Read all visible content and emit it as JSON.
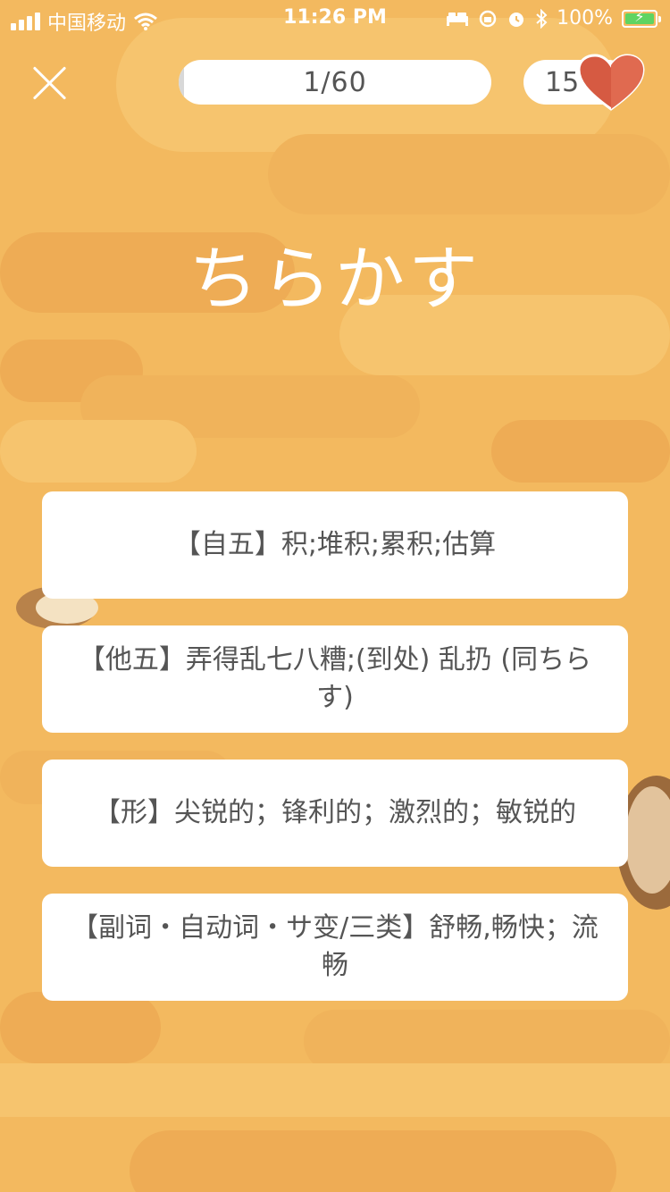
{
  "status_bar": {
    "carrier": "中国移动",
    "time": "11:26 PM",
    "battery_percent": "100%",
    "icons": [
      "signal-icon",
      "wifi-icon",
      "bed-icon",
      "orientation-lock-icon",
      "alarm-icon",
      "bluetooth-icon",
      "battery-charging-icon"
    ]
  },
  "header": {
    "progress_text": "1/60",
    "progress_fraction": 0.0167,
    "lives_count": "15",
    "icons": [
      "close-icon",
      "heart-icon"
    ]
  },
  "question": {
    "word": "ちらかす"
  },
  "options": [
    {
      "label": "【自五】积;堆积;累积;估算"
    },
    {
      "label": "【他五】弄得乱七八糟;(到处) 乱扔 (同ちらす)"
    },
    {
      "label": "【形】尖锐的；锋利的；激烈的；敏锐的"
    },
    {
      "label": "【副词・自动词・サ变/三类】舒畅,畅快；流畅"
    }
  ],
  "colors": {
    "background": "#f3b95f",
    "accent_heart": "#d65a42",
    "card": "#ffffff",
    "text": "#555555"
  }
}
